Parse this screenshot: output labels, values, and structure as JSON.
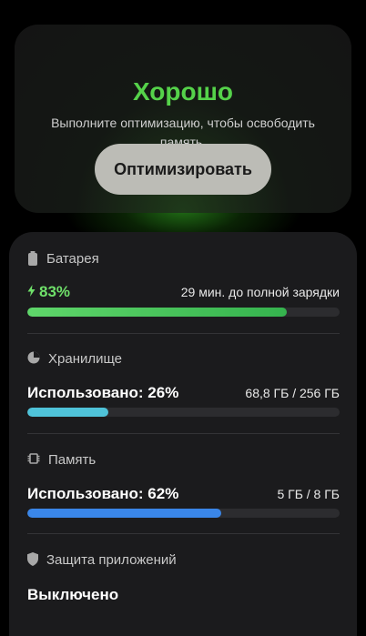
{
  "colors": {
    "accent_green": "#55d24a",
    "battery_bar": "#4cc85a",
    "storage_bar": "#4fc3d9",
    "memory_bar": "#3a86e8",
    "card_bg": "#1b1b1d"
  },
  "header": {
    "status": "Хорошо",
    "description": "Выполните оптимизацию, чтобы освободить память.",
    "optimize_label": "Оптимизировать"
  },
  "battery": {
    "title": "Батарея",
    "icon": "battery-icon",
    "percent_text": "83%",
    "charging_icon": "lightning-icon",
    "status_text": "29 мин. до полной зарядки",
    "level": 0.83
  },
  "storage": {
    "title": "Хранилище",
    "icon": "pie-chart-icon",
    "used_text": "Использовано: 26%",
    "capacity_text": "68,8 ГБ / 256 ГБ",
    "level": 0.26
  },
  "memory": {
    "title": "Память",
    "icon": "memory-chip-icon",
    "used_text": "Использовано: 62%",
    "capacity_text": "5 ГБ / 8 ГБ",
    "level": 0.62
  },
  "app_protection": {
    "title": "Защита приложений",
    "icon": "shield-icon",
    "state": "Выключено"
  }
}
